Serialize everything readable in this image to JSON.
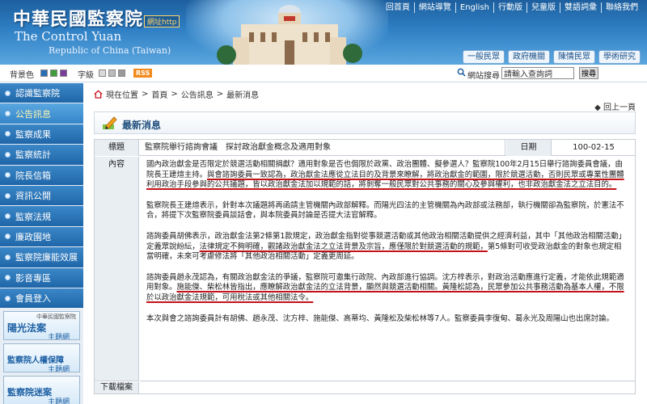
{
  "header": {
    "title_zh": "中華民國監察院",
    "title_url": "網址http",
    "title_en_line1": "The Control Yuan",
    "title_en_line2": "Republic of China (Taiwan)",
    "top_links": [
      "回首頁",
      "網站導覽",
      "English",
      "行動版",
      "兒童版",
      "雙語詞彙",
      "聯絡我們"
    ],
    "quick_links": [
      "一般民眾",
      "政府機關",
      "陳情民眾",
      "學術研究"
    ]
  },
  "toolbar": {
    "bg_label": "背景色",
    "font_label": "字級",
    "rss": "RSS",
    "search_label": "網站搜尋",
    "search_value": "請輸入查詢詞",
    "search_button": "搜尋",
    "swatch_colors": [
      "#2a6fb5",
      "#3f9c3a",
      "#7a3d9a",
      "#f28a1c"
    ]
  },
  "sidebar": {
    "items": [
      {
        "label": "認識監察院"
      },
      {
        "label": "公告訊息"
      },
      {
        "label": "監察成果"
      },
      {
        "label": "監察統計"
      },
      {
        "label": "院長信箱"
      },
      {
        "label": "資訊公開"
      },
      {
        "label": "監察法規"
      },
      {
        "label": "廉政園地"
      },
      {
        "label": "監察院廉能效展"
      },
      {
        "label": "影音專區"
      },
      {
        "label": "會員登入"
      }
    ],
    "banners": [
      {
        "top": "中華民國監察院",
        "main": "陽光法案",
        "sub": "主題網"
      },
      {
        "top": "",
        "main": "監察院人權保障",
        "sub": "主題網"
      },
      {
        "top": "",
        "main": "監察院迷案",
        "sub": "主題網"
      }
    ]
  },
  "breadcrumb": {
    "prefix": "現在位置",
    "items": [
      "首頁",
      "公告訊息",
      "最新消息"
    ],
    "sep": ">"
  },
  "back_link": "回上一頁",
  "section_title": "最新消息",
  "table": {
    "title_label": "標題",
    "title_value": "監察院舉行諮詢會議　探討政治獻金概念及適用對象",
    "date_label": "日期",
    "date_value": "100-02-15",
    "content_label": "內容",
    "download_label": "下載檔案",
    "paragraphs": [
      {
        "plain_1": "國內政治獻金是否限定於競選活動相關捐獻？適用對象是否也侷限於政黨、政治團體、擬參選人？監察院100年2月15日舉行諮詢委員會議，由院長王建煊主持。",
        "underlined": "與會諮詢委員一致認為，政治獻金法應從立法目的及背景來瞭解，將政治獻金的範圍，限於競選活動，否則民眾或專業性團體利用政治手段參與的公共議題，皆以政治獻金法加以規範的話，將剝奪一般民眾對公共事務的關心及參與權利，也非政治獻金法之立法目的。",
        "plain_2": ""
      },
      {
        "plain_1": "監察院長王建煊表示，針對本次議題將再函請主管機關內政部解釋。而陽光四法的主管機關為內政部或法務部，執行機關卻為監察院，於憲法不合，將提下次監察院委員談話會，與本院委員討論是否提大法官解釋。",
        "underlined": "",
        "plain_2": ""
      },
      {
        "plain_1": "諮詢委員胡佛表示，政治獻金法第2條第1款規定，政治獻金指對從事競選活動或其他政治相關活動提供之經濟利益，其中「其他政治相關活動」定義眾說紛紜，",
        "underlined": "法律規定不夠明確，觀諸政治獻金法之立法背景及宗旨，應僅限於對競選活動的規範，",
        "plain_2": "第5條對可收受政治獻金的對象也規定相當明確，未來可考慮修法將「其他政治相關活動」定義更周延。"
      },
      {
        "plain_1": "諮詢委員趙永茂認為，有關政治獻金法的爭議，監察院可邀集行政院、內政部進行協調。沈方梓表示，對政治活動應進行定義，才能依此規範適用對象。",
        "underlined": "施能傑、柴松林皆指出，應瞭解政治獻金法的立法背景，顯然與競選活動相關。黃隆松認為，民眾參加公共事務活動為基本人權，不限於以政治獻金法規範，可用稅法或其他相關法令。",
        "plain_2": ""
      },
      {
        "plain_1": "本次與會之諮詢委員計有胡佛、趙永茂、沈方梓、施能傑、高蒂均、黃隆松及柴松林等7人。監察委員李復甸、葛永光及周陽山也出席討論。",
        "underlined": "",
        "plain_2": ""
      }
    ]
  }
}
